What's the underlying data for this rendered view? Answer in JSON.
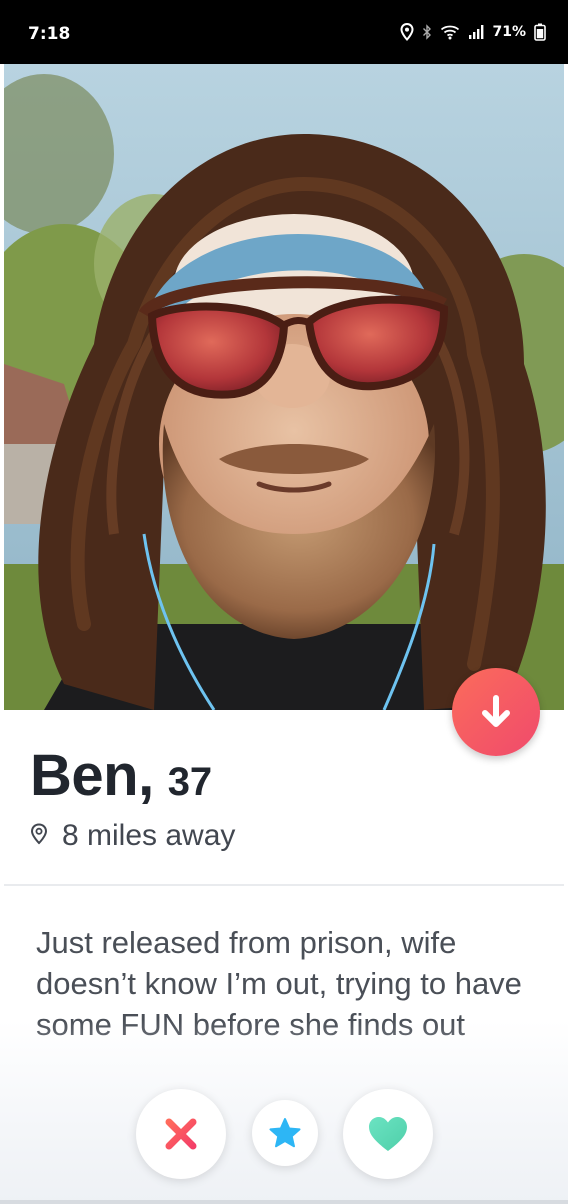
{
  "status_bar": {
    "time": "7:18",
    "battery": "71%",
    "icons": [
      "location-icon",
      "bluetooth-icon",
      "wifi-icon",
      "signal-icon",
      "battery-icon"
    ]
  },
  "profile": {
    "photo": "profile-photo",
    "name": "Ben,",
    "age": "37",
    "distance": "8 miles away",
    "bio": "Just released from prison, wife doesn’t know I’m out, trying to have some FUN before she finds out"
  },
  "actions": {
    "open_profile_icon": "arrow-down-icon",
    "nope_icon": "close-icon",
    "super_like_icon": "star-icon",
    "like_icon": "heart-icon"
  },
  "colors": {
    "accent_red": "#fd5068",
    "down_button": "#f04a6c",
    "nope": "#fd5068",
    "super_like": "#2db6f5",
    "like": "#5ed8b6",
    "text_primary": "#21262e"
  }
}
